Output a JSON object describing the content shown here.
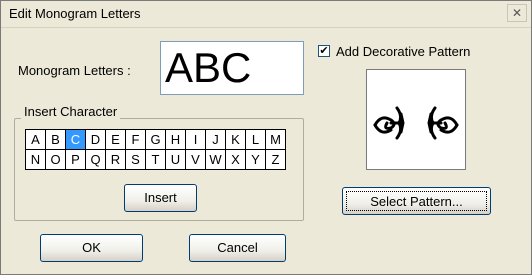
{
  "window": {
    "title": "Edit Monogram Letters",
    "close_glyph": "✕"
  },
  "monogram": {
    "label": "Monogram Letters :",
    "value": "ABC"
  },
  "decorative": {
    "label": "Add Decorative Pattern",
    "checked": true,
    "check_glyph": "✔"
  },
  "insert_group": {
    "title": "Insert Character",
    "rows": [
      [
        "A",
        "B",
        "C",
        "D",
        "E",
        "F",
        "G",
        "H",
        "I",
        "J",
        "K",
        "L",
        "M"
      ],
      [
        "N",
        "O",
        "P",
        "Q",
        "R",
        "S",
        "T",
        "U",
        "V",
        "W",
        "X",
        "Y",
        "Z"
      ]
    ],
    "selected": "C",
    "insert_label": "Insert"
  },
  "buttons": {
    "ok": "OK",
    "cancel": "Cancel",
    "select_pattern": "Select Pattern..."
  },
  "colors": {
    "selection": "#3399ff",
    "dialog_bg": "#ece9d8"
  }
}
